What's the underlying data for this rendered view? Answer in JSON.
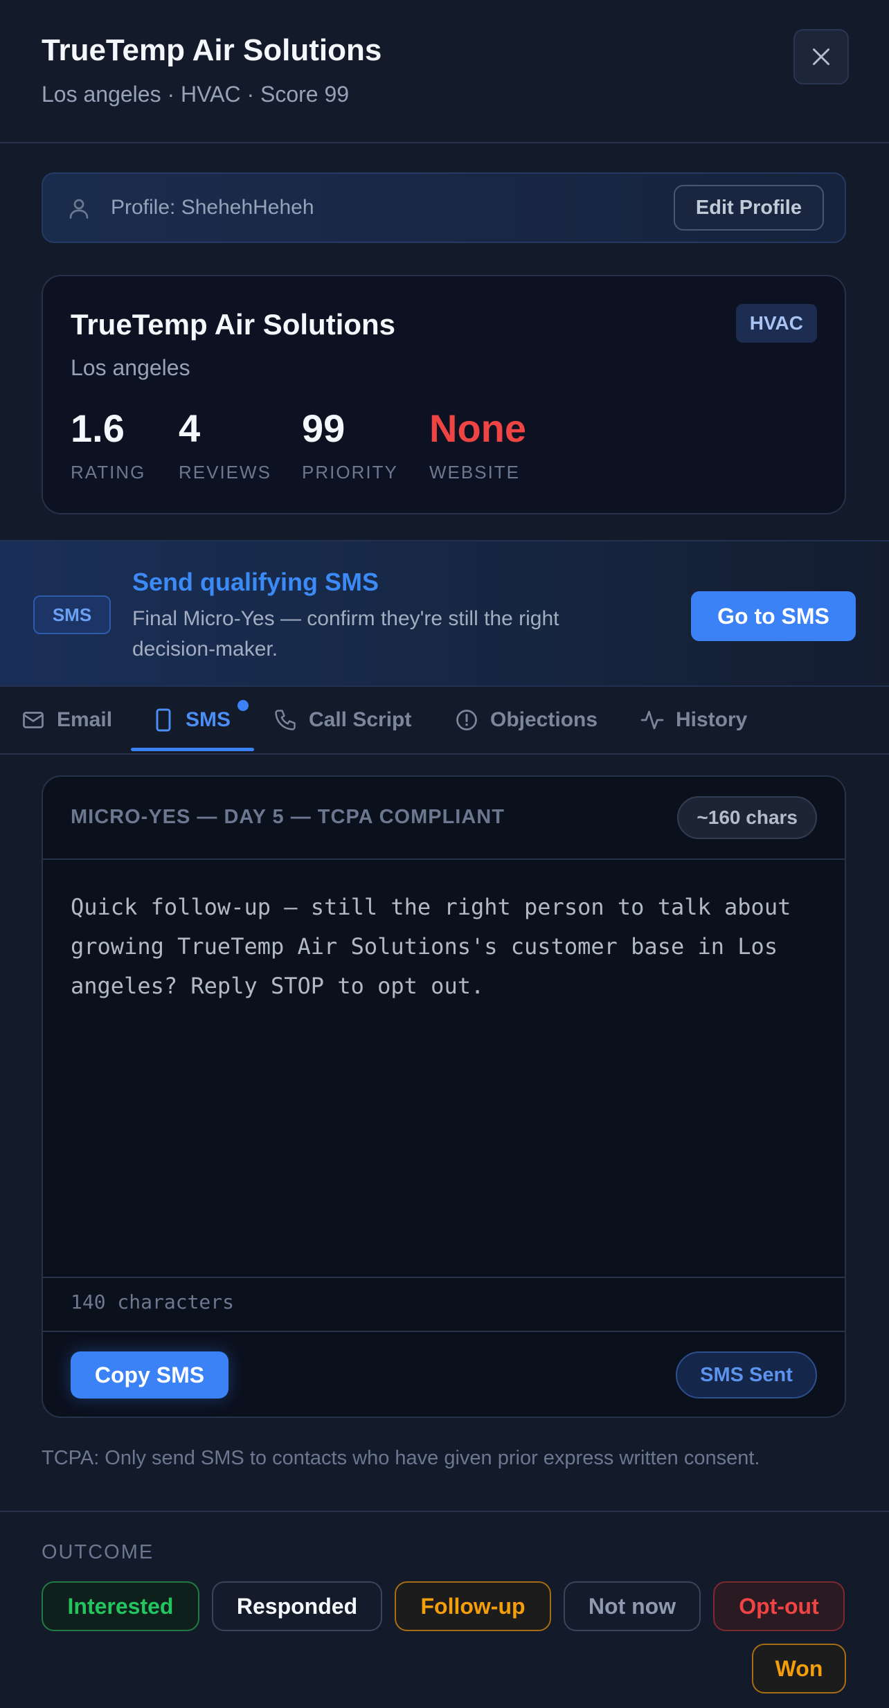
{
  "header": {
    "title": "TrueTemp Air Solutions",
    "subtitle": "Los angeles · HVAC · Score 99"
  },
  "profile": {
    "label": "Profile: ShehehHeheh",
    "edit_label": "Edit Profile"
  },
  "business": {
    "name": "TrueTemp Air Solutions",
    "city": "Los angeles",
    "category": "HVAC",
    "stats": [
      {
        "value": "1.6",
        "label": "RATING"
      },
      {
        "value": "4",
        "label": "REVIEWS"
      },
      {
        "value": "99",
        "label": "PRIORITY"
      },
      {
        "value": "None",
        "label": "WEBSITE"
      }
    ]
  },
  "banner": {
    "badge": "SMS",
    "title": "Send qualifying SMS",
    "description": "Final Micro-Yes — confirm they're still the right decision-maker.",
    "button": "Go to SMS"
  },
  "tabs": [
    {
      "label": "Email",
      "icon": "mail-icon"
    },
    {
      "label": "SMS",
      "icon": "phone-device-icon",
      "active": true
    },
    {
      "label": "Call Script",
      "icon": "phone-icon"
    },
    {
      "label": "Objections",
      "icon": "alert-circle-icon"
    },
    {
      "label": "History",
      "icon": "activity-icon"
    }
  ],
  "composer": {
    "label": "MICRO-YES — DAY 5 — TCPA COMPLIANT",
    "char_pill": "~160 chars",
    "body": "Quick follow-up — still the right person to talk about growing TrueTemp Air Solutions's customer base in Los angeles? Reply STOP to opt out.",
    "char_count": "140 characters",
    "copy_label": "Copy SMS",
    "sent_label": "SMS Sent"
  },
  "tcpa_note": "TCPA: Only send SMS to contacts who have given prior express written consent.",
  "outcome": {
    "label": "OUTCOME",
    "options": [
      "Interested",
      "Responded",
      "Follow-up",
      "Not now",
      "Opt-out",
      "Won"
    ]
  },
  "colors": {
    "accent": "#3b82f6",
    "danger": "#ef4444",
    "success": "#22c55e",
    "warning": "#f59e0b"
  }
}
